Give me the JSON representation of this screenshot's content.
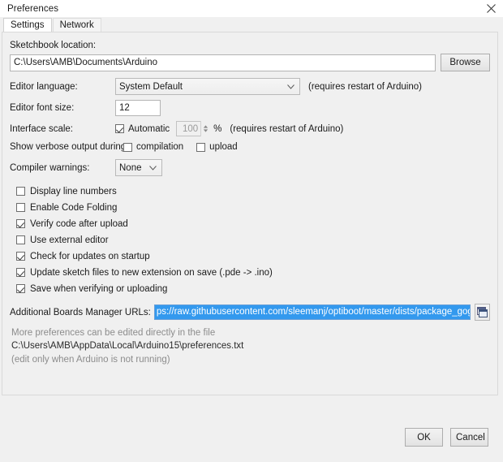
{
  "window": {
    "title": "Preferences",
    "close_icon": "close-icon"
  },
  "tabs": [
    {
      "label": "Settings",
      "active": true
    },
    {
      "label": "Network",
      "active": false
    }
  ],
  "settings": {
    "sketchbook": {
      "label": "Sketchbook location:",
      "value": "C:\\Users\\AMB\\Documents\\Arduino",
      "browse_label": "Browse"
    },
    "editor_language": {
      "label": "Editor language:",
      "value": "System Default",
      "hint": "(requires restart of Arduino)"
    },
    "editor_font_size": {
      "label": "Editor font size:",
      "value": "12"
    },
    "interface_scale": {
      "label": "Interface scale:",
      "automatic_label": "Automatic",
      "automatic_checked": true,
      "percent_value": "100",
      "percent_symbol": "%",
      "hint": "(requires restart of Arduino)"
    },
    "verbose_output": {
      "label": "Show verbose output during:",
      "compilation_label": "compilation",
      "compilation_checked": false,
      "upload_label": "upload",
      "upload_checked": false
    },
    "compiler_warnings": {
      "label": "Compiler warnings:",
      "value": "None"
    },
    "options": [
      {
        "label": "Display line numbers",
        "checked": false
      },
      {
        "label": "Enable Code Folding",
        "checked": false
      },
      {
        "label": "Verify code after upload",
        "checked": true
      },
      {
        "label": "Use external editor",
        "checked": false
      },
      {
        "label": "Check for updates on startup",
        "checked": true
      },
      {
        "label": "Update sketch files to new extension on save (.pde -> .ino)",
        "checked": true
      },
      {
        "label": "Save when verifying or uploading",
        "checked": true
      }
    ],
    "boards_manager": {
      "label": "Additional Boards Manager URLs:",
      "value": "ps://raw.githubusercontent.com/sleemanj/optiboot/master/dists/package_gogo_diy_attiny_index.json",
      "edit_icon": "window-edit-icon"
    },
    "notes": {
      "line1": "More preferences can be edited directly in the file",
      "line2": "C:\\Users\\AMB\\AppData\\Local\\Arduino15\\preferences.txt",
      "line3": "(edit only when Arduino is not running)"
    }
  },
  "footer": {
    "ok_label": "OK",
    "cancel_label": "Cancel"
  },
  "colors": {
    "selection": "#3399ee",
    "dialog_bg": "#f0f0f0"
  }
}
